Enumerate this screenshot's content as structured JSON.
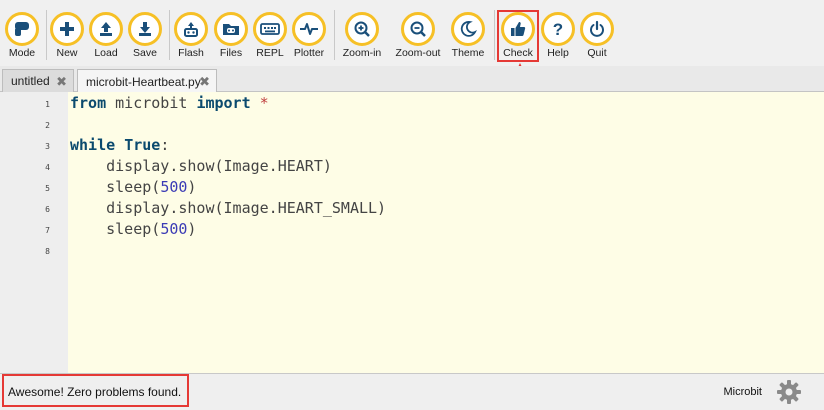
{
  "toolbar": {
    "buttons": [
      {
        "label": "Mode",
        "icon": "mode-icon"
      },
      {
        "label": "New",
        "icon": "plus-icon"
      },
      {
        "label": "Load",
        "icon": "upload-icon"
      },
      {
        "label": "Save",
        "icon": "download-icon"
      },
      {
        "label": "Flash",
        "icon": "flash-icon"
      },
      {
        "label": "Files",
        "icon": "files-icon"
      },
      {
        "label": "REPL",
        "icon": "keyboard-icon"
      },
      {
        "label": "Plotter",
        "icon": "pulse-icon"
      },
      {
        "label": "Zoom-in",
        "icon": "zoom-in-icon"
      },
      {
        "label": "Zoom-out",
        "icon": "zoom-out-icon"
      },
      {
        "label": "Theme",
        "icon": "moon-icon"
      },
      {
        "label": "Check",
        "icon": "thumbs-up-icon"
      },
      {
        "label": "Help",
        "icon": "question-icon"
      },
      {
        "label": "Quit",
        "icon": "power-icon"
      }
    ]
  },
  "tabs": [
    {
      "label": "untitled"
    },
    {
      "label": "microbit-Heartbeat.py"
    }
  ],
  "editor": {
    "line_numbers": [
      "1",
      "2",
      "3",
      "4",
      "5",
      "6",
      "7",
      "8"
    ],
    "lines": {
      "l1": {
        "a": "from",
        "b": " microbit ",
        "c": "import",
        "d": " *"
      },
      "l3": {
        "a": "while",
        "b": " ",
        "c": "True",
        "d": ":"
      },
      "l4": {
        "a": "    display.show(Image.HEART)"
      },
      "l5": {
        "a": "    sleep(",
        "b": "500",
        "c": ")"
      },
      "l6": {
        "a": "    display.show(Image.HEART_SMALL)"
      },
      "l7": {
        "a": "    sleep(",
        "b": "500",
        "c": ")"
      }
    }
  },
  "status": {
    "message": "Awesome! Zero problems found.",
    "mode": "Microbit"
  },
  "colors": {
    "accent": "#f6c026",
    "highlight": "#e53935",
    "editor_bg": "#fefde6"
  }
}
